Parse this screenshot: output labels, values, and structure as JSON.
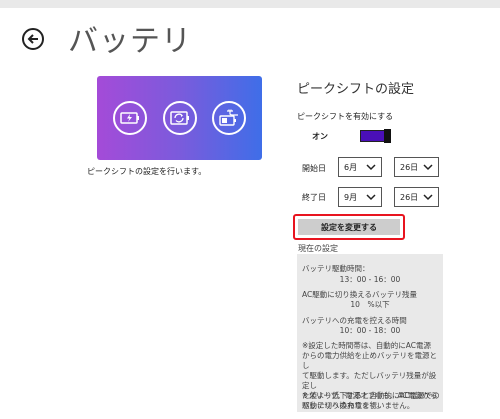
{
  "header": {
    "title": "バッテリ"
  },
  "hero": {
    "icons": [
      "battery-charging-icon",
      "sync-icon",
      "battery-plug-icon"
    ]
  },
  "description": "ピークシフトの設定を行います。",
  "settings": {
    "section_title": "ピークシフトの設定",
    "enable_label": "ピークシフトを有効にする",
    "toggle_state_label": "オン",
    "start": {
      "label": "開始日",
      "month": "6月",
      "day": "26日"
    },
    "end": {
      "label": "終了日",
      "month": "9月",
      "day": "26日"
    },
    "change_button": "設定を変更する"
  },
  "current": {
    "heading": "現在の設定",
    "drive_label": "バッテリ駆動時間：",
    "drive_value": "13：00 - 16：00",
    "switch_label": "AC駆動に切り換えるバッテリ残量",
    "switch_value": "10　%以下",
    "charge_label": "バッテリへの充電を控える時間",
    "charge_value": "10：00 - 18：00",
    "note1_lines": [
      "※設定した時間帯は、自動的にAC電源",
      "からの電力供給を止めバッテリを電源とし",
      "て駆動します。ただしバッテリ残量が設定し",
      "た値より低下すると自動的にAC電源での",
      "駆動に切り換わります。"
    ],
    "note2_lines": [
      "※スリープ、電源オフ中も、AC電源から",
      "バッテリへの充電を行いません。"
    ]
  },
  "colors": {
    "accent": "#4a0fb8",
    "highlight": "#e8141f",
    "button_bg": "#cdcdcd"
  }
}
